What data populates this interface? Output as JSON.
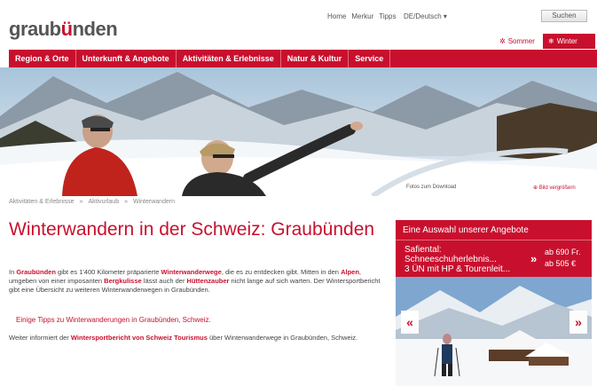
{
  "header": {
    "logo_part1": "graub",
    "logo_accent": "ü",
    "logo_part2": "nden",
    "links": [
      "Home",
      "Merkur",
      "Tipps"
    ],
    "language": "DE/Deutsch ▾",
    "search_label": "Suchen"
  },
  "season_tabs": [
    {
      "label": "Sommer",
      "icon": "sun-icon"
    },
    {
      "label": "Winter",
      "icon": "snowflake-icon"
    }
  ],
  "nav": {
    "items": [
      "Region & Orte",
      "Unterkunft & Angebote",
      "Aktivitäten & Erlebnisse",
      "Natur & Kultur",
      "Service"
    ]
  },
  "hero": {
    "credit": "Fotos zum Download",
    "zoom_label": "Bild vergrößern"
  },
  "breadcrumb": [
    "Aktivitäten & Erlebnisse",
    "»",
    "Aktivurlaub",
    "»",
    "Winterwandern"
  ],
  "main": {
    "title": "Winterwandern in der Schweiz: Graubünden",
    "intro_pre": "In ",
    "intro_b1": "Graubünden",
    "intro_mid1": " gibt es 1'400 Kilometer präparierte ",
    "intro_b2": "Winterwanderwege",
    "intro_mid2": ", die es zu entdecken gibt. Mitten in den ",
    "intro_b3": "Alpen",
    "intro_mid3": ", umgeben von einer imposanten ",
    "intro_b4": "Bergkulisse",
    "intro_mid4": " lässt auch der ",
    "intro_b5": "Hüttenzauber",
    "intro_end": " nicht lange auf sich warten. Der Wintersportbericht gibt eine Übersicht zu weiteren Winterwanderwegen in Graubünden.",
    "tips_link": "Einige Tipps zu Winterwanderungen in Graubünden, Schweiz.",
    "more_pre": "Weiter informiert der ",
    "more_b": "Wintersportbericht von Schweiz Tourismus",
    "more_end": " über Winterwanderwege in Graubünden, Schweiz."
  },
  "offer": {
    "title": "Eine Auswahl unserer Angebote",
    "name_line1": "Safiental:",
    "name_line2": "Schneeschuherlebnis...",
    "name_line3": "3 ÜN mit HP & Tourenleit...",
    "arrow": "»",
    "price1": "ab 690 Fr.",
    "price2": "ab 505 €",
    "prev": "«",
    "next": "»"
  },
  "colors": {
    "brand_red": "#c8102e",
    "text_gray": "#444444"
  }
}
